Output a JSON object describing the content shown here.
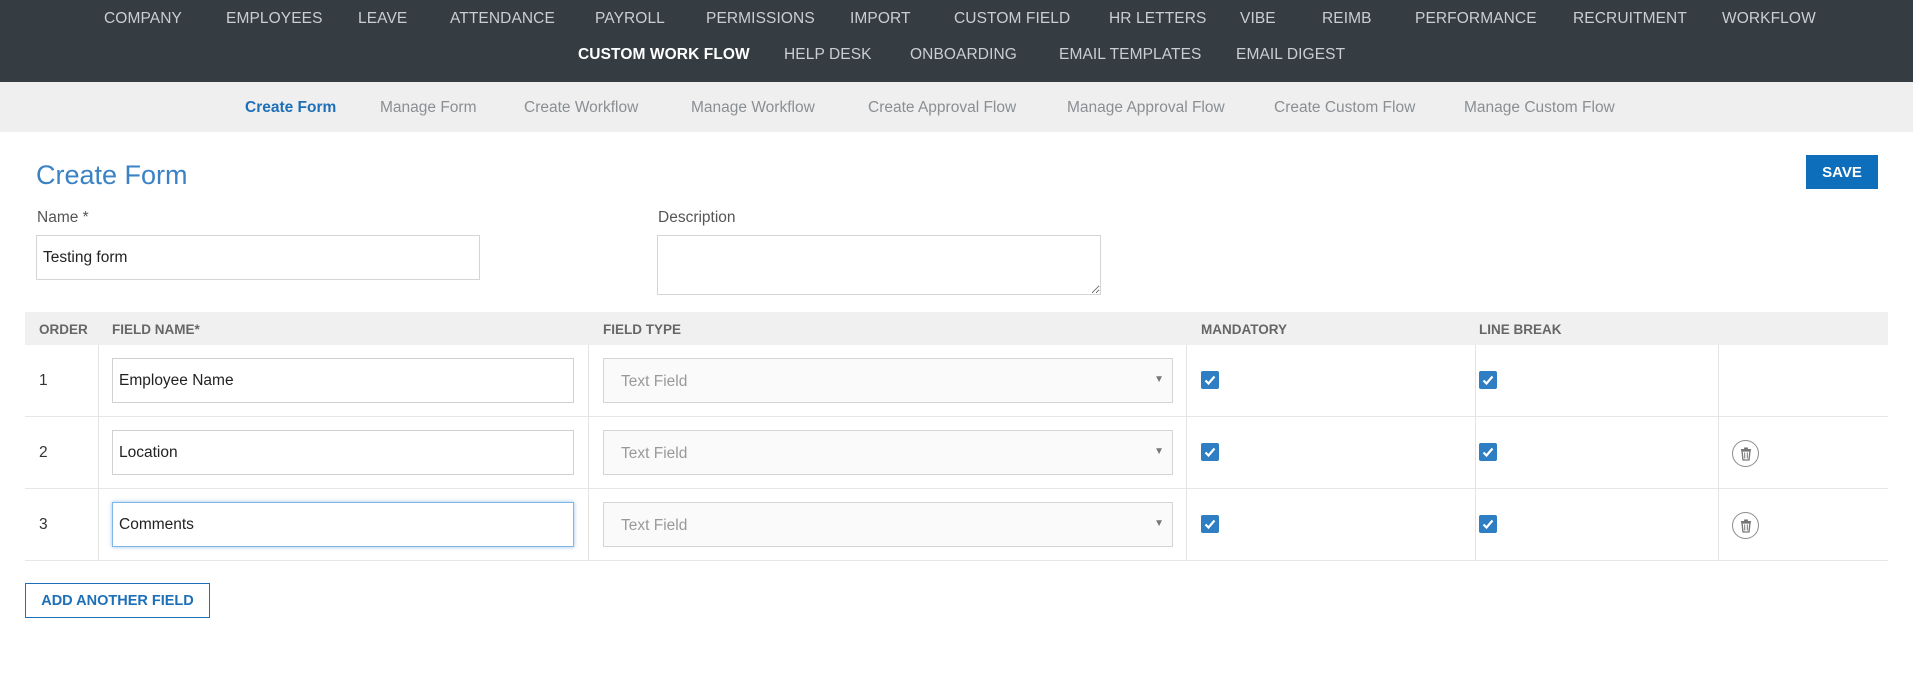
{
  "topnav": {
    "row1": [
      "COMPANY",
      "EMPLOYEES",
      "LEAVE",
      "ATTENDANCE",
      "PAYROLL",
      "PERMISSIONS",
      "IMPORT",
      "CUSTOM FIELD",
      "HR LETTERS",
      "VIBE",
      "REIMB",
      "PERFORMANCE",
      "RECRUITMENT",
      "WORKFLOW"
    ],
    "row2": [
      "CUSTOM WORK FLOW",
      "HELP DESK",
      "ONBOARDING",
      "EMAIL TEMPLATES",
      "EMAIL DIGEST"
    ],
    "active": "CUSTOM WORK FLOW"
  },
  "subnav": {
    "items": [
      "Create Form",
      "Manage Form",
      "Create Workflow",
      "Manage Workflow",
      "Create Approval Flow",
      "Manage Approval Flow",
      "Create Custom Flow",
      "Manage Custom Flow"
    ],
    "active": "Create Form"
  },
  "page": {
    "title": "Create Form",
    "save_label": "SAVE"
  },
  "form": {
    "name_label": "Name *",
    "name_value": "Testing form",
    "description_label": "Description",
    "description_value": ""
  },
  "table": {
    "headers": {
      "order": "ORDER",
      "field_name": "FIELD NAME*",
      "field_type": "FIELD TYPE",
      "mandatory": "MANDATORY",
      "line_break": "LINE BREAK"
    },
    "rows": [
      {
        "order": "1",
        "field_name": "Employee Name",
        "field_type": "Text Field",
        "mandatory": true,
        "line_break": true,
        "deletable": false
      },
      {
        "order": "2",
        "field_name": "Location",
        "field_type": "Text Field",
        "mandatory": true,
        "line_break": true,
        "deletable": true
      },
      {
        "order": "3",
        "field_name": "Comments",
        "field_type": "Text Field",
        "mandatory": true,
        "line_break": true,
        "deletable": true
      }
    ]
  },
  "add_field_label": "ADD ANOTHER FIELD",
  "colors": {
    "topnav_bg": "#363d42",
    "accent": "#1d6fb8",
    "checkbox": "#2f7dc2"
  }
}
